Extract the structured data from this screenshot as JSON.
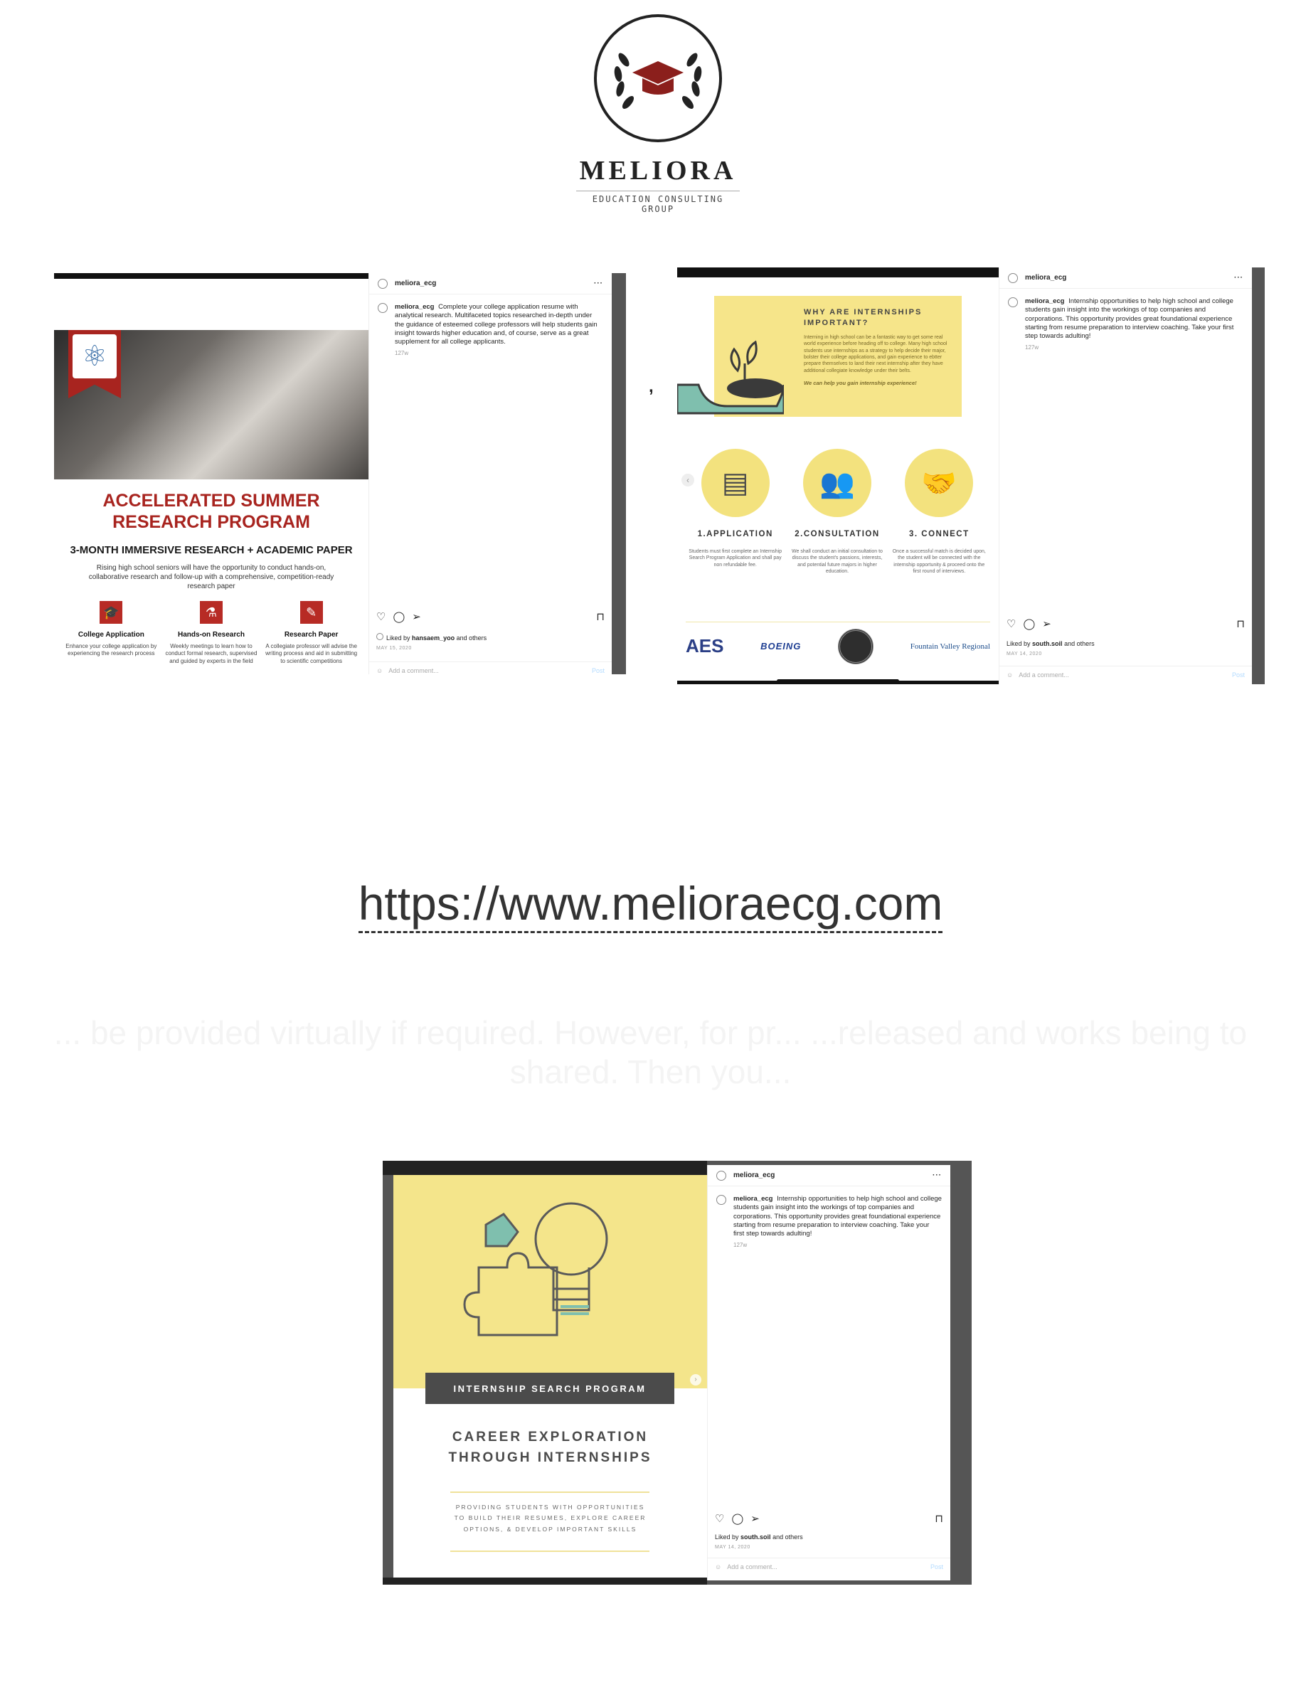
{
  "logo": {
    "wordmark": "MELIORA",
    "subtitle": "EDUCATION CONSULTING GROUP"
  },
  "separator": ",",
  "post_research": {
    "username": "meliora_ecg",
    "menu": "···",
    "caption_user": "meliora_ecg",
    "caption": "Complete your college application resume with analytical research. Multifaceted topics researched in-depth under the guidance of esteemed college professors will help students gain insight towards higher education and, of course, serve as a great supplement for all college applicants.",
    "age": "127w",
    "liked_by_prefix": "Liked by",
    "liked_by_user": "hansaem_yoo",
    "liked_by_suffix": "and others",
    "date": "MAY 15, 2020",
    "comment_placeholder": "Add a comment...",
    "post_button": "Post",
    "image": {
      "title": "ACCELERATED SUMMER RESEARCH PROGRAM",
      "subtitle": "3-MONTH IMMERSIVE RESEARCH + ACADEMIC PAPER",
      "lead": "Rising high school seniors will have the opportunity to conduct hands-on, collaborative research and follow-up with a comprehensive, competition-ready research paper",
      "columns": [
        {
          "title": "College Application",
          "text": "Enhance your college application by experiencing the research process"
        },
        {
          "title": "Hands-on Research",
          "text": "Weekly meetings to learn how to conduct formal research, supervised and guided by experts in the field"
        },
        {
          "title": "Research Paper",
          "text": "A collegiate professor will advise the writing process and aid in submitting to scientific competitions"
        }
      ]
    }
  },
  "post_internships": {
    "username": "meliora_ecg",
    "menu": "···",
    "caption_user": "meliora_ecg",
    "caption": "Internship opportunities to help high school and college students gain insight into the workings of top companies and corporations. This opportunity provides great foundational experience starting from resume preparation to interview coaching. Take your first step towards adulting!",
    "age": "127w",
    "liked_by_prefix": "Liked by",
    "liked_by_user": "south.soil",
    "liked_by_suffix": "and others",
    "date": "MAY 14, 2020",
    "comment_placeholder": "Add a comment...",
    "post_button": "Post",
    "image": {
      "box_title": "WHY ARE INTERNSHIPS IMPORTANT?",
      "box_text": "Interning in high school can be a fantastic way to get some real world experience before heading off to college. Many high school students use internships as a strategy to help decide their major, bolster their college applications, and gain experience to ebtter prepare themselves to land their next internship after they have additional collegiate knowledge under their belts.",
      "box_cta": "We can help you gain internship experience!",
      "steps": [
        {
          "title": "1.APPLICATION",
          "text": "Students must first complete an Internship Search Program Application and shall pay non refundable fee."
        },
        {
          "title": "2.CONSULTATION",
          "text": "We shall conduct an initial consultation to discuss the student's passions, interests, and potential future majors in higher education."
        },
        {
          "title": "3. CONNECT",
          "text": "Once a successful match is decided upon, the student will be connected with the internship opportunity & proceed onto the first round of interviews."
        }
      ],
      "partners": [
        "AES",
        "BOEING",
        "Fountain Valley Regional"
      ]
    }
  },
  "url": "https://www.melioraecg.com",
  "ghost_text": "... be provided virtually if required. However, for pr... ...released and works being to shared. Then you...",
  "post_career": {
    "username": "meliora_ecg",
    "menu": "···",
    "caption_user": "meliora_ecg",
    "caption": "Internship opportunities to help high school and college students gain insight into the workings of top companies and corporations. This opportunity provides great foundational experience starting from resume preparation to interview coaching. Take your first step towards adulting!",
    "age": "127w",
    "liked_by_prefix": "Liked by",
    "liked_by_user": "south.soil",
    "liked_by_suffix": "and others",
    "date": "MAY 14, 2020",
    "comment_placeholder": "Add a comment...",
    "post_button": "Post",
    "image": {
      "ribbon": "INTERNSHIP SEARCH PROGRAM",
      "title_line1": "CAREER EXPLORATION",
      "title_line2": "THROUGH INTERNSHIPS",
      "sub_line1": "PROVIDING STUDENTS WITH OPPORTUNITIES",
      "sub_line2": "TO BUILD THEIR RESUMES, EXPLORE CAREER",
      "sub_line3": "OPTIONS, & DEVELOP IMPORTANT SKILLS"
    }
  },
  "colors": {
    "brand_red": "#a8241f",
    "accent_yellow": "#f4e58b",
    "teal": "#7fbfae"
  }
}
